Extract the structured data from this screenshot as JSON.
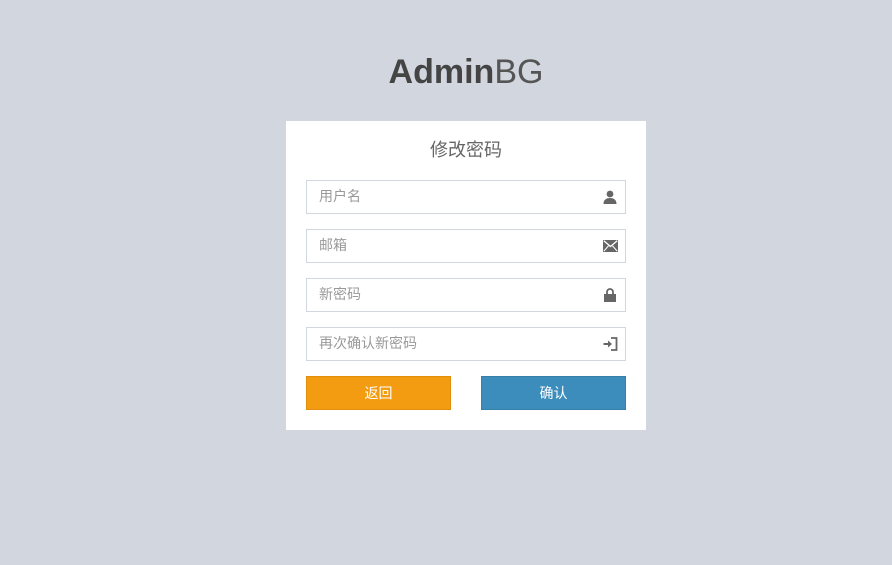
{
  "logo": {
    "bold": "Admin",
    "light": "BG"
  },
  "form": {
    "title": "修改密码",
    "fields": [
      {
        "placeholder": "用户名",
        "icon": "user-icon"
      },
      {
        "placeholder": "邮箱",
        "icon": "envelope-icon"
      },
      {
        "placeholder": "新密码",
        "icon": "lock-icon"
      },
      {
        "placeholder": "再次确认新密码",
        "icon": "log-in-icon"
      }
    ],
    "back_label": "返回",
    "confirm_label": "确认"
  },
  "colors": {
    "background": "#d2d6de",
    "back_button": "#f39c12",
    "confirm_button": "#3c8dbc"
  }
}
